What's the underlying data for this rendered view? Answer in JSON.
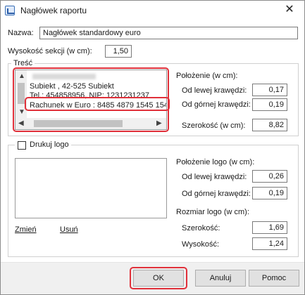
{
  "window": {
    "title": "Nagłówek raportu",
    "close_glyph": "✕"
  },
  "form": {
    "name_label": "Nazwa:",
    "name_value": "Nagłówek standardowy euro",
    "height_label": "Wysokość sekcji (w cm):",
    "height_value": "1,50"
  },
  "content_group": {
    "legend": "Treść",
    "lines": [
      "Subiekt , 42-525 Subiekt",
      "Tel.: 454858956, NIP: 1231231237",
      "Rachunek w Euro : 8485 4879 1545 154"
    ],
    "position_label": "Położenie (w cm):",
    "left_label": "Od lewej krawędzi:",
    "left_value": "0,17",
    "top_label": "Od górnej krawędzi:",
    "top_value": "0,19",
    "width_label": "Szerokość (w cm):",
    "width_value": "8,82"
  },
  "logo_group": {
    "legend": "Drukuj logo",
    "checked": false,
    "position_label": "Położenie logo (w cm):",
    "left_label": "Od lewej krawędzi:",
    "left_value": "0,26",
    "top_label": "Od górnej krawędzi:",
    "top_value": "0,19",
    "size_label": "Rozmiar logo (w cm):",
    "width_label": "Szerokość:",
    "width_value": "1,69",
    "height_label": "Wysokość:",
    "height_value": "1,24",
    "change_link": "Zmień",
    "remove_link": "Usuń"
  },
  "buttons": {
    "ok": "OK",
    "cancel": "Anuluj",
    "help": "Pomoc"
  },
  "colors": {
    "highlight": "#e0303a",
    "button_bg": "#e1e1e1"
  }
}
